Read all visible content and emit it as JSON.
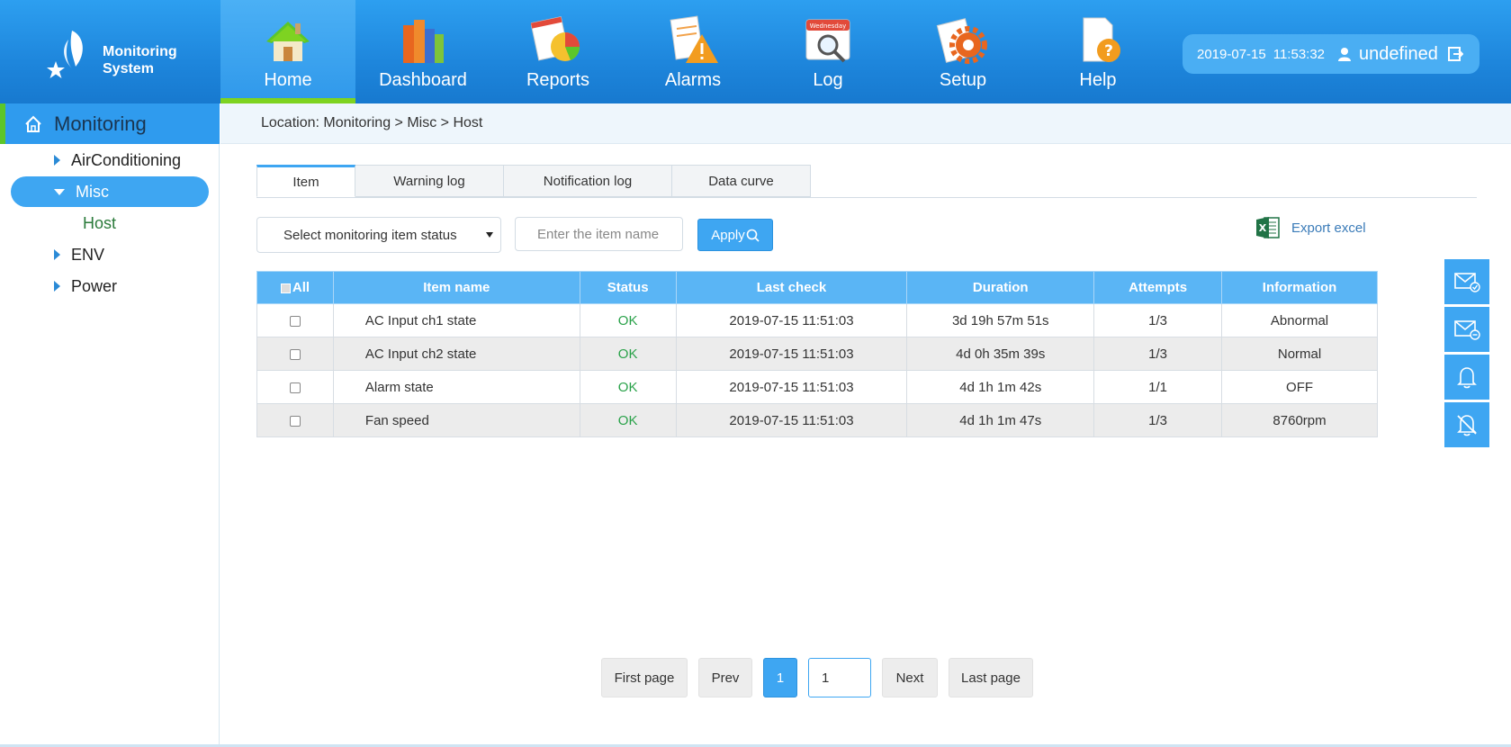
{
  "app": {
    "logo_line1": "Monitoring",
    "logo_line2": "System"
  },
  "nav": [
    {
      "label": "Home",
      "icon": "house-icon",
      "active": true
    },
    {
      "label": "Dashboard",
      "icon": "books-icon"
    },
    {
      "label": "Reports",
      "icon": "pie-chart-report-icon"
    },
    {
      "label": "Alarms",
      "icon": "warning-icon"
    },
    {
      "label": "Log",
      "icon": "calendar-search-icon"
    },
    {
      "label": "Setup",
      "icon": "gear-icon"
    },
    {
      "label": "Help",
      "icon": "help-document-icon"
    }
  ],
  "calendar_badge": "Wednesday",
  "user": {
    "date": "2019-07-15",
    "time": "11:53:32",
    "name": "undefined"
  },
  "sidebar": {
    "title": "Monitoring",
    "items": [
      {
        "label": "AirConditioning"
      },
      {
        "label": "Misc"
      },
      {
        "label": "Host"
      },
      {
        "label": "ENV"
      },
      {
        "label": "Power"
      }
    ]
  },
  "location": "Location: Monitoring > Misc > Host",
  "tabs": [
    "Item",
    "Warning log",
    "Notification log",
    "Data curve"
  ],
  "filters": {
    "status_select": "Select monitoring item status",
    "name_placeholder": "Enter the item name",
    "apply_label": "Apply",
    "export_label": "Export excel"
  },
  "table": {
    "columns": [
      "All",
      "Item name",
      "Status",
      "Last check",
      "Duration",
      "Attempts",
      "Information"
    ],
    "rows": [
      {
        "name": "AC Input ch1 state",
        "status": "OK",
        "last_check": "2019-07-15 11:51:03",
        "duration": "3d 19h 57m 51s",
        "attempts": "1/3",
        "info": "Abnormal"
      },
      {
        "name": "AC Input ch2 state",
        "status": "OK",
        "last_check": "2019-07-15 11:51:03",
        "duration": "4d 0h 35m 39s",
        "attempts": "1/3",
        "info": "Normal"
      },
      {
        "name": "Alarm state",
        "status": "OK",
        "last_check": "2019-07-15 11:51:03",
        "duration": "4d 1h 1m 42s",
        "attempts": "1/1",
        "info": "OFF"
      },
      {
        "name": "Fan speed",
        "status": "OK",
        "last_check": "2019-07-15 11:51:03",
        "duration": "4d 1h 1m 47s",
        "attempts": "1/3",
        "info": "8760rpm"
      }
    ]
  },
  "pager": {
    "first": "First page",
    "prev": "Prev",
    "current": "1",
    "input": "1",
    "next": "Next",
    "last": "Last page"
  },
  "colors": {
    "primary": "#3ea6f2",
    "header": "#1e86dc",
    "active_accent": "#7ed321",
    "ok": "#2aa24a"
  }
}
